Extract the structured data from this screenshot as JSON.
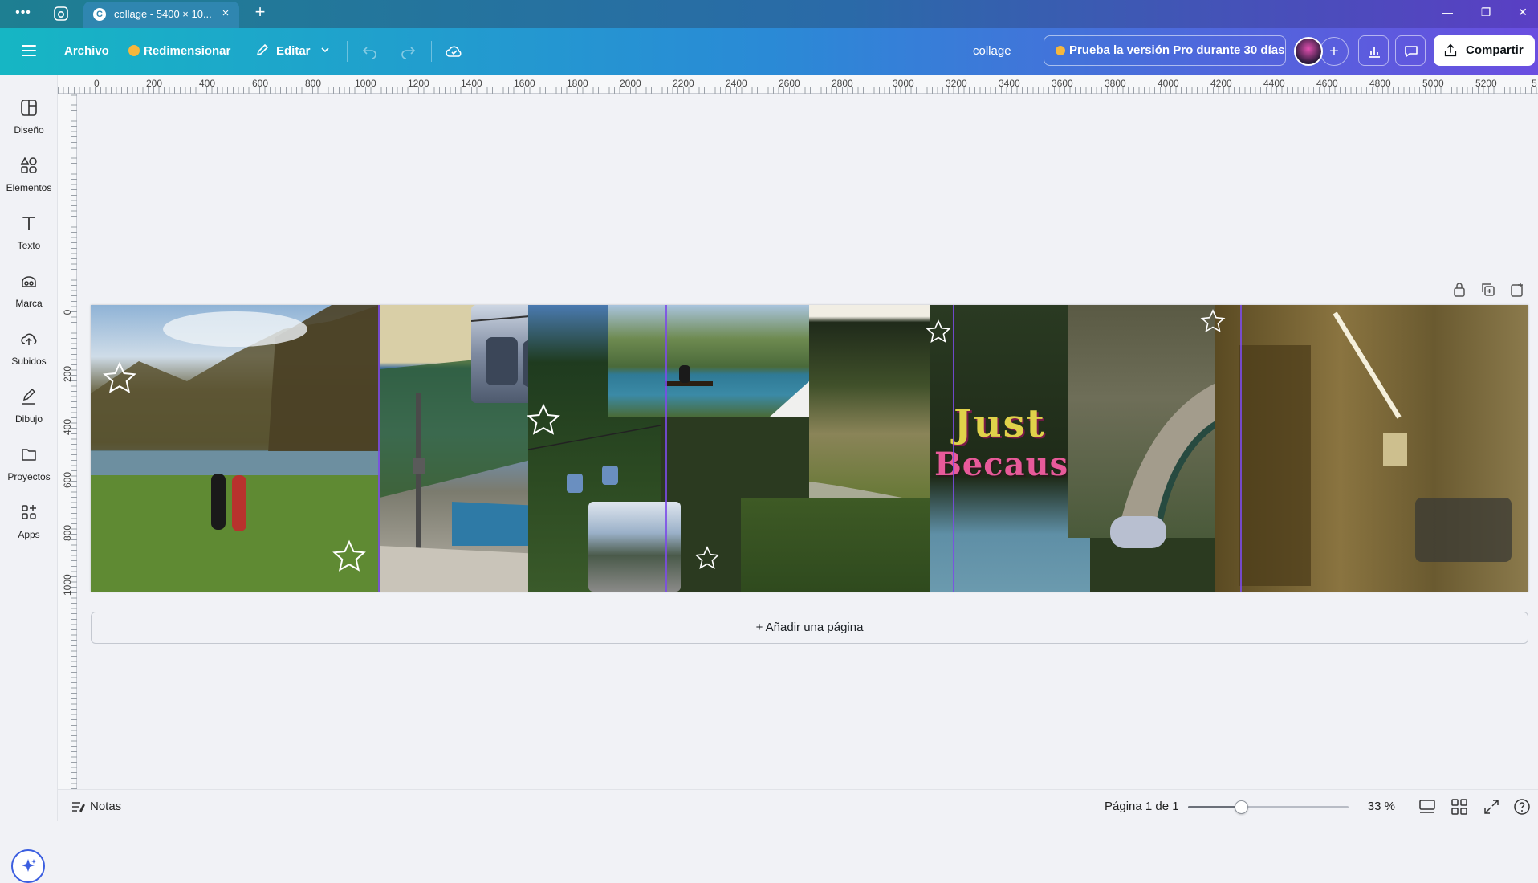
{
  "browser": {
    "tab_title": "collage - 5400 × 10...",
    "favicon_letter": "C",
    "menu_dots": "•••",
    "close_glyph": "×",
    "new_tab_glyph": "+",
    "win_minimize": "—",
    "win_restore": "❐",
    "win_close": "✕"
  },
  "toolbar": {
    "archivo": "Archivo",
    "redimensionar": "Redimensionar",
    "editar": "Editar",
    "doc_title": "collage",
    "pro_trial": "Prueba la versión Pro durante 30 días",
    "add_glyph": "+",
    "share": "Compartir"
  },
  "sidebar": {
    "items": [
      {
        "label": "Diseño",
        "icon": "layout-icon"
      },
      {
        "label": "Elementos",
        "icon": "shapes-icon"
      },
      {
        "label": "Texto",
        "icon": "text-icon"
      },
      {
        "label": "Marca",
        "icon": "brand-icon"
      },
      {
        "label": "Subidos",
        "icon": "cloud-upload-icon"
      },
      {
        "label": "Dibujo",
        "icon": "pen-icon"
      },
      {
        "label": "Proyectos",
        "icon": "folder-icon"
      },
      {
        "label": "Apps",
        "icon": "apps-icon"
      }
    ]
  },
  "ruler": {
    "top": [
      "0",
      "200",
      "400",
      "600",
      "800",
      "1000",
      "1200",
      "1400",
      "1600",
      "1800",
      "2000",
      "2200",
      "2400",
      "2600",
      "2800",
      "3000",
      "3200",
      "3400",
      "3600",
      "3800",
      "4000",
      "4200",
      "4400",
      "4600",
      "4800",
      "5000",
      "5200",
      "5"
    ],
    "left": [
      "0",
      "200",
      "400",
      "600",
      "800",
      "1000"
    ]
  },
  "canvas": {
    "collage_text_line1": "Just",
    "collage_text_line2": "Because",
    "add_page": "+ Añadir una página"
  },
  "bottom": {
    "notes": "Notas",
    "page_indicator": "Página 1 de 1",
    "zoom_fraction": 0.33,
    "zoom_label": "33 %"
  },
  "colors": {
    "accent": "#2a8ad6",
    "guide": "#7b4be8"
  }
}
